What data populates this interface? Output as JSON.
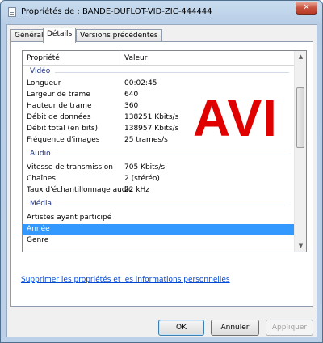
{
  "window": {
    "title": "Propriétés de : BANDE-DUFLOT-VID-ZIC-444444",
    "close_label": "✕"
  },
  "tabs": [
    {
      "label": "Général",
      "active": false
    },
    {
      "label": "Détails",
      "active": true
    },
    {
      "label": "Versions précédentes",
      "active": false
    }
  ],
  "list": {
    "columns": {
      "property": "Propriété",
      "value": "Valeur"
    },
    "groups": {
      "video": "Vidéo",
      "audio": "Audio",
      "media": "Média"
    },
    "video_rows": [
      {
        "k": "Longueur",
        "v": "00:02:45"
      },
      {
        "k": "Largeur de trame",
        "v": "640"
      },
      {
        "k": "Hauteur de trame",
        "v": "360"
      },
      {
        "k": "Débit de données",
        "v": "138251 Kbits/s"
      },
      {
        "k": "Débit total (en bits)",
        "v": "138957 Kbits/s"
      },
      {
        "k": "Fréquence d'images",
        "v": "25 trames/s"
      }
    ],
    "audio_rows": [
      {
        "k": "Vitesse de transmission",
        "v": "705 Kbits/s"
      },
      {
        "k": "Chaînes",
        "v": "2 (stéréo)"
      },
      {
        "k": "Taux d'échantillonnage audio",
        "v": "22 kHz"
      }
    ],
    "media_rows": [
      {
        "k": "Artistes ayant participé",
        "v": ""
      },
      {
        "k": "Année",
        "v": ""
      },
      {
        "k": "Genre",
        "v": ""
      }
    ],
    "selected_row": "Année"
  },
  "overlay_text": "AVI",
  "remove_link": "Supprimer les propriétés et les informations personnelles",
  "buttons": {
    "ok": "OK",
    "cancel": "Annuler",
    "apply": "Appliquer"
  },
  "colors": {
    "selection": "#3399ff",
    "group": "#1e3287",
    "overlay": "#e00000",
    "link": "#0046d5"
  }
}
